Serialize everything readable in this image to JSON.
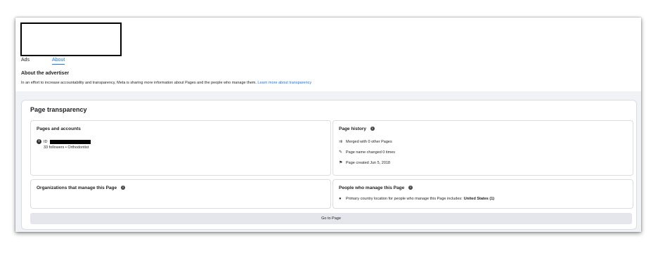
{
  "tabs": {
    "ads": "Ads",
    "about": "About"
  },
  "about": {
    "title": "About the advertiser",
    "description": "In an effort to increase accountability and transparency, Meta is sharing more information about Pages and the people who manage them.",
    "learn_more": "Learn more about transparency"
  },
  "transparency": {
    "title": "Page transparency",
    "pages_accounts": {
      "title": "Pages and accounts",
      "id_label": "ID",
      "followers": "33 followers • Orthodontist"
    },
    "page_history": {
      "title": "Page history",
      "items": [
        {
          "icon": "merge-icon",
          "text": "Merged with 0 other Pages"
        },
        {
          "icon": "edit-icon",
          "text": "Page name changed 0 times"
        },
        {
          "icon": "flag-icon",
          "text": "Page created Jun 5, 2018"
        }
      ]
    },
    "orgs": {
      "title": "Organizations that manage this Page"
    },
    "people": {
      "title": "People who manage this Page",
      "location_prefix": "Primary country location for people who manage this Page includes:",
      "location_value": "United States (1)"
    },
    "goto_button": "Go to Page"
  },
  "colors": {
    "link": "#1877f2",
    "background": "#f0f2f5",
    "button": "#e4e6eb"
  }
}
